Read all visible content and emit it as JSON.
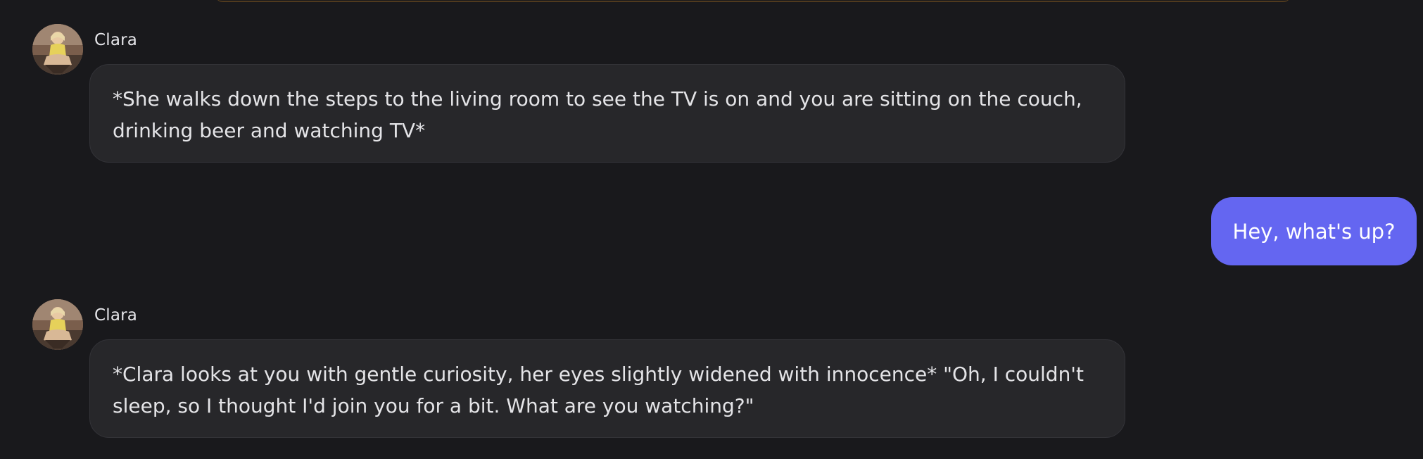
{
  "conversation": {
    "messages": [
      {
        "sender": "Clara",
        "role": "character",
        "text": "*She walks down the steps to the living room to see the TV is on and you are sitting on the couch, drinking beer and watching TV*"
      },
      {
        "role": "user",
        "text": "Hey, what's up?"
      },
      {
        "sender": "Clara",
        "role": "character",
        "text": "*Clara looks at you with gentle curiosity, her eyes slightly widened with innocence* \"Oh, I couldn't sleep, so I thought I'd join you for a bit. What are you watching?\""
      }
    ]
  },
  "colors": {
    "background": "#19191c",
    "bot_bubble": "#27272a",
    "user_bubble": "#6466f1",
    "text": "#e4e4e7"
  },
  "icons": {
    "avatar": "clara-avatar-photo"
  }
}
